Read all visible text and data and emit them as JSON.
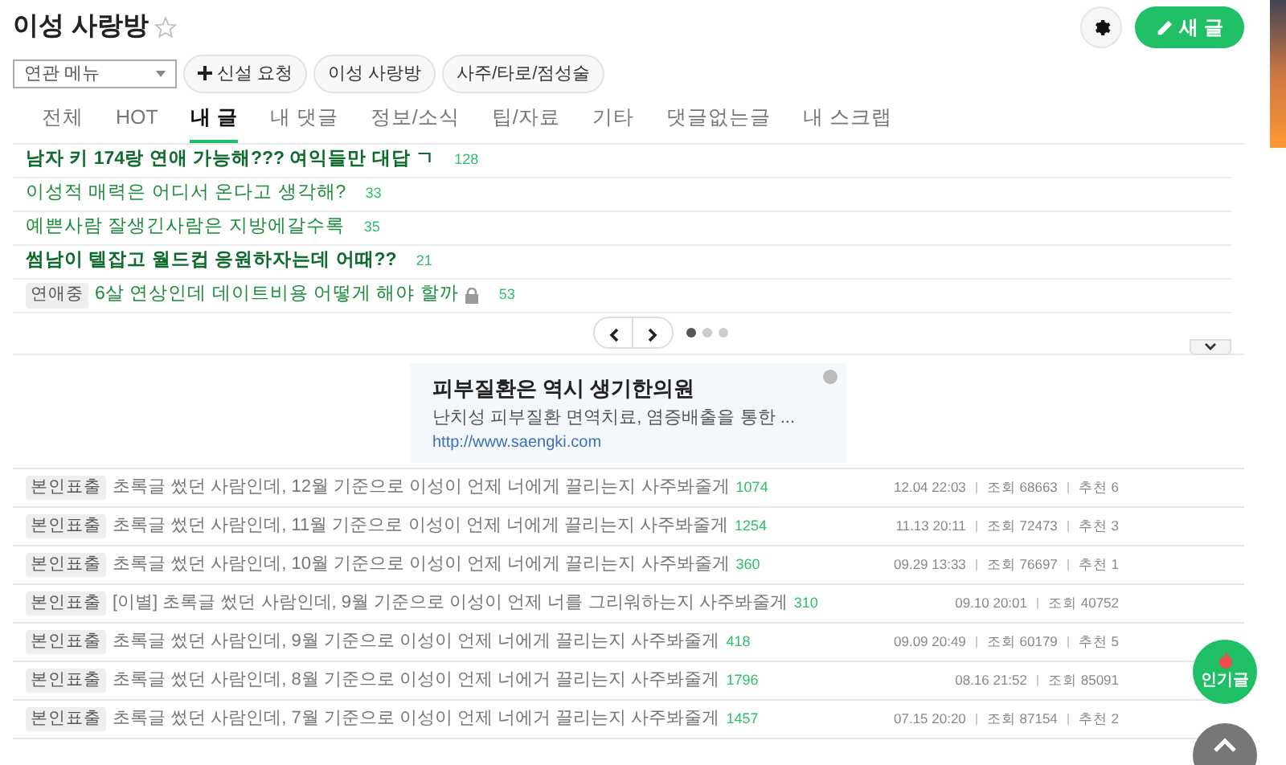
{
  "header": {
    "title": "이성 사랑방",
    "favorite": false,
    "new_post_button": "새 글"
  },
  "related_menu": {
    "label": "연관 메뉴"
  },
  "chips": [
    "신설 요청",
    "이성 사랑방",
    "사주/타로/점성술"
  ],
  "tabs": [
    {
      "label": "전체",
      "selected": false
    },
    {
      "label": "HOT",
      "selected": false
    },
    {
      "label": "내 글",
      "selected": true
    },
    {
      "label": "내 댓글",
      "selected": false
    },
    {
      "label": "정보/소식",
      "selected": false
    },
    {
      "label": "팁/자료",
      "selected": false
    },
    {
      "label": "기타",
      "selected": false
    },
    {
      "label": "댓글없는글",
      "selected": false
    },
    {
      "label": "내 스크랩",
      "selected": false
    }
  ],
  "my_posts": [
    {
      "title": "남자 키 174랑 연애 가능해??? 여익들만 대답 ㄱ",
      "comments": "128",
      "bold": true,
      "locked": false
    },
    {
      "title": "이성적 매력은 어디서 온다고 생각해?",
      "comments": "33",
      "bold": false,
      "locked": false
    },
    {
      "title": "예쁜사람 잘생긴사람은 지방에갈수록",
      "comments": "35",
      "bold": false,
      "locked": false
    },
    {
      "title": "썸남이 텔잡고 월드컵 응원하자는데 어때??",
      "comments": "21",
      "bold": true,
      "locked": false
    },
    {
      "tag": "연애중",
      "title": "6살 연상인데 데이트비용 어떻게 해야 할까",
      "comments": "53",
      "bold": false,
      "locked": true
    }
  ],
  "pager": {
    "pages": [
      {
        "selected": true
      },
      {
        "selected": false
      },
      {
        "selected": false
      }
    ]
  },
  "ad": {
    "title": "피부질환은 역시 생기한의원",
    "text": "난치성 피부질환 면역치료, 염증배출을 통한 ...",
    "url": "http://www.saengki.com"
  },
  "posts": [
    {
      "tag": "본인표출",
      "title": "초록글 썼던 사람인데, 12월 기준으로 이성이 언제 너에게 끌리는지 사주봐줄게",
      "comments": "1074",
      "date": "12.04 22:03",
      "views": "조회 68663",
      "likes": "추천 6"
    },
    {
      "tag": "본인표출",
      "title": "초록글 썼던 사람인데, 11월 기준으로 이성이 언제 너에게 끌리는지 사주봐줄게",
      "comments": "1254",
      "date": "11.13 20:11",
      "views": "조회 72473",
      "likes": "추천 3"
    },
    {
      "tag": "본인표출",
      "title": "초록글 썼던 사람인데, 10월 기준으로 이성이 언제 너에게 끌리는지 사주봐줄게",
      "comments": "360",
      "date": "09.29 13:33",
      "views": "조회 76697",
      "likes": "추천 1"
    },
    {
      "tag": "본인표출",
      "title": "[이별] 초록글 썼던 사람인데, 9월 기준으로 이성이 언제 너를 그리워하는지 사주봐줄게",
      "comments": "310",
      "date": "09.10 20:01",
      "views": "조회 40752"
    },
    {
      "tag": "본인표출",
      "title": "초록글 썼던 사람인데, 9월 기준으로 이성이 언제 너에게 끌리는지 사주봐줄게",
      "comments": "418",
      "date": "09.09 20:49",
      "views": "조회 60179",
      "likes": "추천 5"
    },
    {
      "tag": "본인표출",
      "title": "초록글 썼던 사람인데, 8월 기준으로 이성이 언제 너에거 끌리는지 사주봐줄게",
      "comments": "1796",
      "date": "08.16 21:52",
      "views": "조회 85091"
    },
    {
      "tag": "본인표출",
      "title": "초록글 썼던 사람인데, 7월 기준으로 이성이 언제 너에거 끌리는지 사주봐줄게",
      "comments": "1457",
      "date": "07.15 20:20",
      "views": "조회 87154",
      "likes": "추천 2"
    }
  ],
  "popular_button": "인기글"
}
